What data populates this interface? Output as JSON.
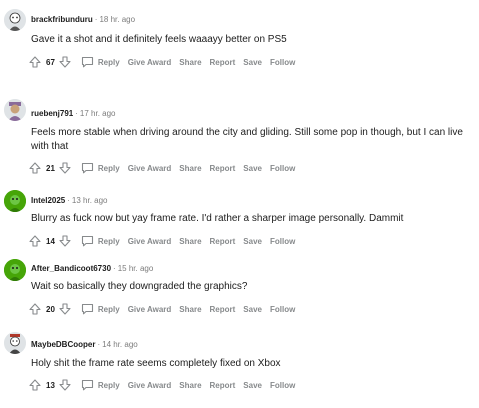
{
  "actions": {
    "reply": "Reply",
    "give_award": "Give Award",
    "share": "Share",
    "report": "Report",
    "save": "Save",
    "follow": "Follow"
  },
  "comments": [
    {
      "username": "brackfribunduru",
      "time": "18 hr. ago",
      "text": "Gave it a shot and it definitely feels waaayy better on PS5",
      "votes": "67",
      "avatar_color": "#d9dee2"
    },
    {
      "username": "ruebenj791",
      "time": "17 hr. ago",
      "text": "Feels more stable when driving around the city and gliding. Still some pop in though, but I can live with that",
      "votes": "21",
      "avatar_color": "#8a6b9a"
    },
    {
      "username": "Intel2025",
      "time": "13 hr. ago",
      "text": "Blurry as fuck now but yay frame rate. I'd rather a sharper image personally. Dammit",
      "votes": "14",
      "avatar_color": "#46a508"
    },
    {
      "username": "After_Bandicoot6730",
      "time": "15 hr. ago",
      "text": "Wait so basically they downgraded the graphics?",
      "votes": "20",
      "avatar_color": "#46a508"
    },
    {
      "username": "MaybeDBCooper",
      "time": "14 hr. ago",
      "text": "Holy shit the frame rate seems completely fixed on Xbox",
      "votes": "13",
      "avatar_color": "#d9dee2"
    }
  ]
}
